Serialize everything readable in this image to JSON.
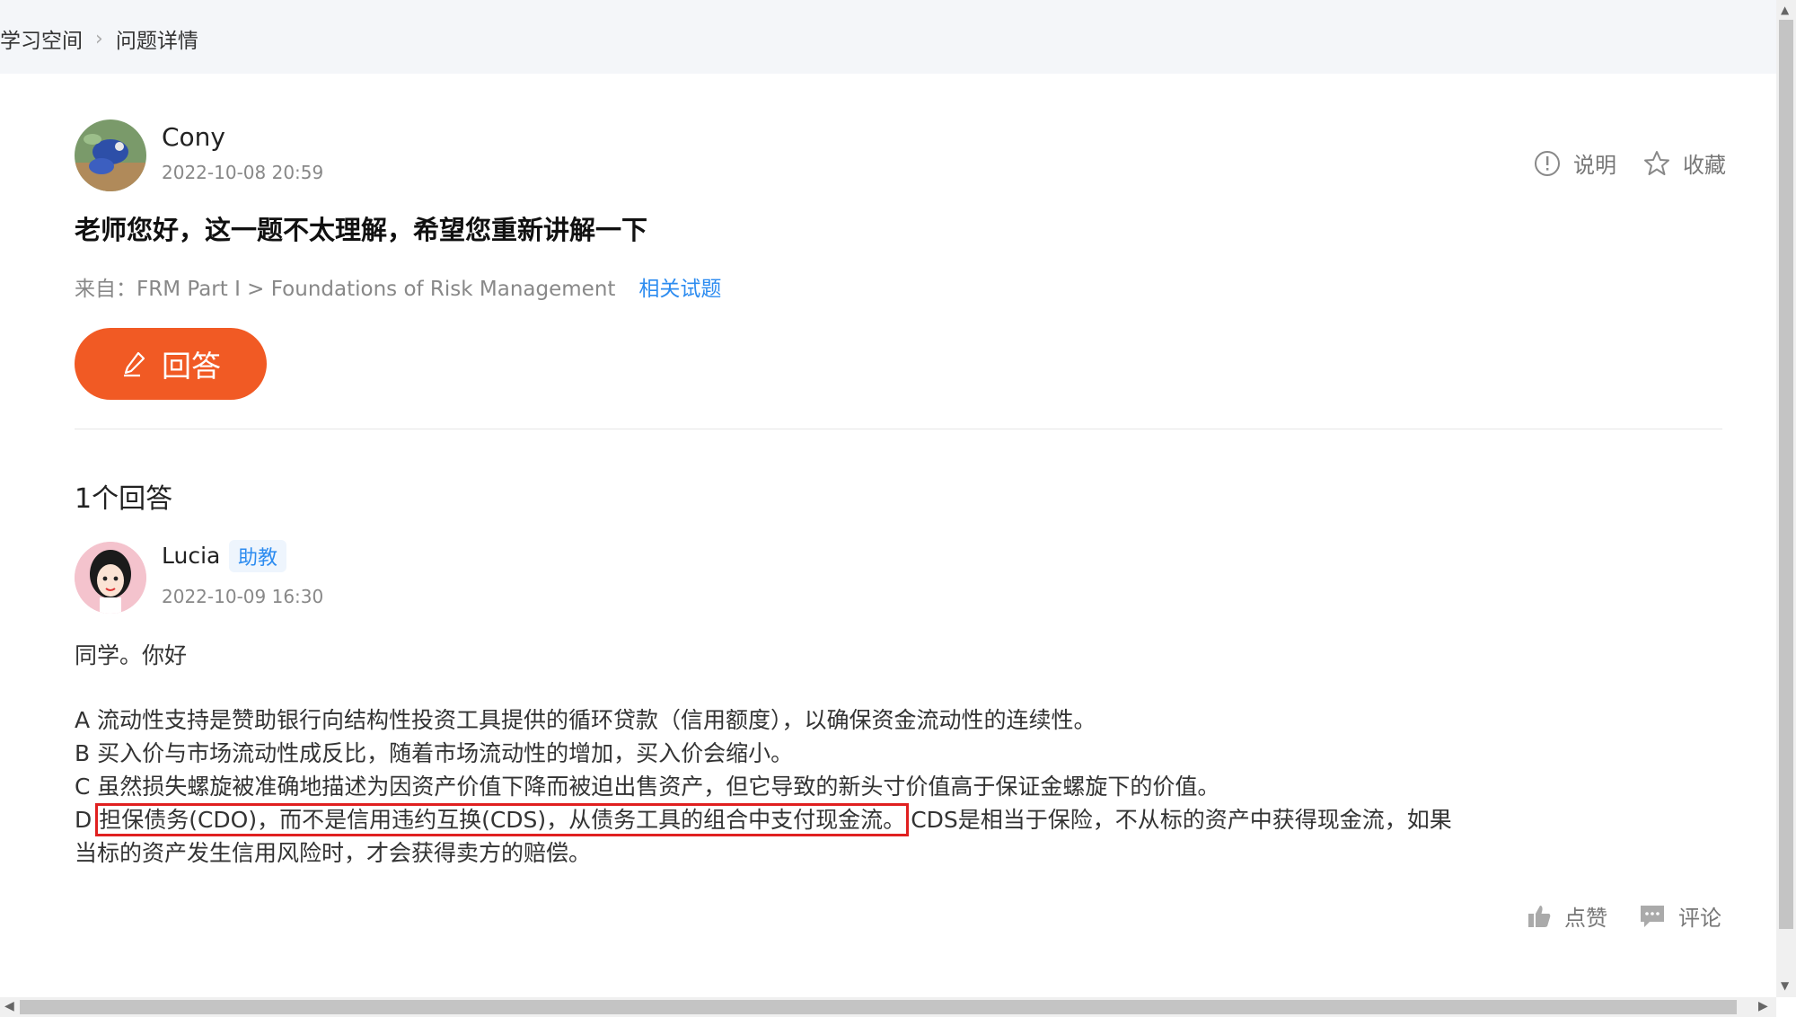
{
  "breadcrumb": {
    "home": "学习空间",
    "current": "问题详情"
  },
  "question": {
    "author": "Cony",
    "time": "2022-10-08 20:59",
    "title": "老师您好，这一题不太理解，希望您重新讲解一下",
    "source_prefix": "来自：FRM Part I > Foundations of Risk Management",
    "related_link": "相关试题"
  },
  "actions": {
    "explain": "说明",
    "favorite": "收藏"
  },
  "answer_button": "回答",
  "answer_count": "1个回答",
  "answer": {
    "author": "Lucia",
    "badge": "助教",
    "time": "2022-10-09 16:30",
    "greeting": "同学。你好",
    "line_a": "A 流动性支持是赞助银行向结构性投资工具提供的循环贷款（信用额度），以确保资金流动性的连续性。",
    "line_b": "B 买入价与市场流动性成反比，随着市场流动性的增加，买入价会缩小。",
    "line_c": "C 虽然损失螺旋被准确地描述为因资产价值下降而被迫出售资产，但它导致的新头寸价值高于保证金螺旋下的价值。",
    "line_d_prefix": "D ",
    "line_d_highlight": "担保债务(CDO)，而不是信用违约互换(CDS)，从债务工具的组合中支付现金流。",
    "line_d_rest": "CDS是相当于保险，不从标的资产中获得现金流，如果",
    "line_e": "当标的资产发生信用风险时，才会获得卖方的赔偿。",
    "like": "点赞",
    "comment": "评论"
  },
  "colors": {
    "accent": "#f15a24",
    "link": "#2d8cf0",
    "highlight_box": "#e02020"
  }
}
